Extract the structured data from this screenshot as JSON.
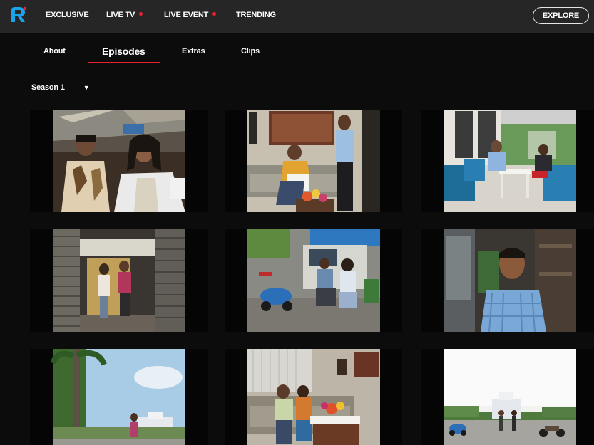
{
  "nav": {
    "logo_icon": "rctv-logo-icon",
    "items": [
      {
        "label": "EXCLUSIVE",
        "live": false
      },
      {
        "label": "LIVE TV",
        "live": true
      },
      {
        "label": "LIVE EVENT",
        "live": true
      },
      {
        "label": "TRENDING",
        "live": false
      }
    ],
    "explore_label": "EXPLORE",
    "colors": {
      "bar": "#262626",
      "live_dot": "#e8232f",
      "accent_logo": "#1aa3e8"
    }
  },
  "tabs": {
    "items": [
      "About",
      "Episodes",
      "Extras",
      "Clips"
    ],
    "active": "Episodes",
    "underline_color": "#e8232f"
  },
  "season": {
    "selected": "Season 1",
    "caret_icon": "triangle-down-icon"
  },
  "episodes": [
    {
      "scene": "market-two-men-smiling"
    },
    {
      "scene": "living-room-man-reading-newspaper"
    },
    {
      "scene": "terrace-blue-chairs-conversation"
    },
    {
      "scene": "shop-shutter-alley-argument"
    },
    {
      "scene": "street-scooter-sitting-men"
    },
    {
      "scene": "man-in-plaid-shirt-closeup"
    },
    {
      "scene": "park-monument-palm-tree"
    },
    {
      "scene": "sofa-couple-with-flowers"
    },
    {
      "scene": "plaza-monument-motorbikes"
    }
  ]
}
